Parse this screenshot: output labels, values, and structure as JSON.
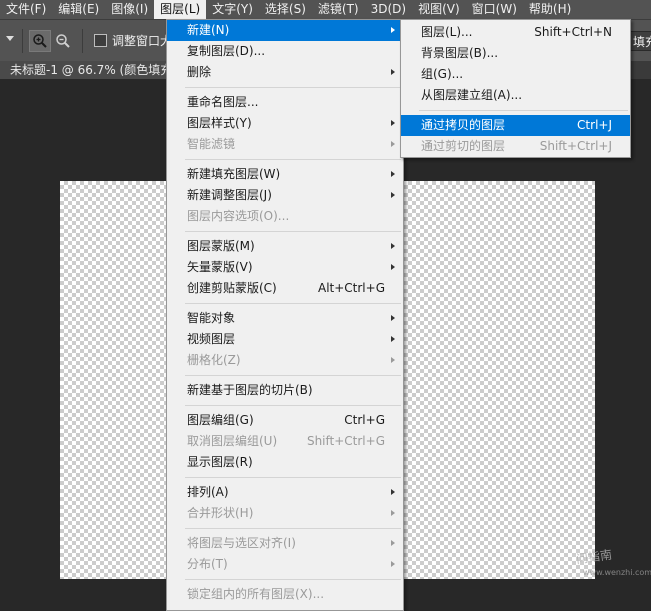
{
  "menubar": {
    "items": [
      "文件(F)",
      "编辑(E)",
      "图像(I)",
      "图层(L)",
      "文字(Y)",
      "选择(S)",
      "滤镜(T)",
      "3D(D)",
      "视图(V)",
      "窗口(W)",
      "帮助(H)"
    ]
  },
  "options": {
    "zoom_in_icon": "zoom-in-icon",
    "zoom_out_icon": "zoom-out-icon",
    "resize_label": "调整窗口大",
    "fill_label": "填充"
  },
  "document": {
    "tab_title": "未标题-1 @ 66.7% (颜色填充"
  },
  "layer_menu": {
    "items": [
      {
        "label": "新建(N)",
        "shortcut": "",
        "submenu": true,
        "disabled": false,
        "highlight": true
      },
      {
        "label": "复制图层(D)...",
        "shortcut": "",
        "submenu": false,
        "disabled": false
      },
      {
        "label": "删除",
        "shortcut": "",
        "submenu": true,
        "disabled": false
      },
      {
        "label": "重命名图层...",
        "shortcut": "",
        "submenu": false,
        "disabled": false
      },
      {
        "label": "图层样式(Y)",
        "shortcut": "",
        "submenu": true,
        "disabled": false
      },
      {
        "label": "智能滤镜",
        "shortcut": "",
        "submenu": true,
        "disabled": true
      },
      {
        "label": "新建填充图层(W)",
        "shortcut": "",
        "submenu": true,
        "disabled": false
      },
      {
        "label": "新建调整图层(J)",
        "shortcut": "",
        "submenu": true,
        "disabled": false
      },
      {
        "label": "图层内容选项(O)...",
        "shortcut": "",
        "submenu": false,
        "disabled": true
      },
      {
        "label": "图层蒙版(M)",
        "shortcut": "",
        "submenu": true,
        "disabled": false
      },
      {
        "label": "矢量蒙版(V)",
        "shortcut": "",
        "submenu": true,
        "disabled": false
      },
      {
        "label": "创建剪贴蒙版(C)",
        "shortcut": "Alt+Ctrl+G",
        "submenu": false,
        "disabled": false
      },
      {
        "label": "智能对象",
        "shortcut": "",
        "submenu": true,
        "disabled": false
      },
      {
        "label": "视频图层",
        "shortcut": "",
        "submenu": true,
        "disabled": false
      },
      {
        "label": "栅格化(Z)",
        "shortcut": "",
        "submenu": true,
        "disabled": true
      },
      {
        "label": "新建基于图层的切片(B)",
        "shortcut": "",
        "submenu": false,
        "disabled": false
      },
      {
        "label": "图层编组(G)",
        "shortcut": "Ctrl+G",
        "submenu": false,
        "disabled": false
      },
      {
        "label": "取消图层编组(U)",
        "shortcut": "Shift+Ctrl+G",
        "submenu": false,
        "disabled": true
      },
      {
        "label": "显示图层(R)",
        "shortcut": "",
        "submenu": false,
        "disabled": false
      },
      {
        "label": "排列(A)",
        "shortcut": "",
        "submenu": true,
        "disabled": false
      },
      {
        "label": "合并形状(H)",
        "shortcut": "",
        "submenu": true,
        "disabled": true
      },
      {
        "label": "将图层与选区对齐(I)",
        "shortcut": "",
        "submenu": true,
        "disabled": true
      },
      {
        "label": "分布(T)",
        "shortcut": "",
        "submenu": true,
        "disabled": true
      },
      {
        "label": "锁定组内的所有图层(X)...",
        "shortcut": "",
        "submenu": false,
        "disabled": true
      }
    ]
  },
  "new_submenu": {
    "items": [
      {
        "label": "图层(L)...",
        "shortcut": "Shift+Ctrl+N",
        "disabled": false
      },
      {
        "label": "背景图层(B)...",
        "shortcut": "",
        "disabled": false
      },
      {
        "label": "组(G)...",
        "shortcut": "",
        "disabled": false
      },
      {
        "label": "从图层建立组(A)...",
        "shortcut": "",
        "disabled": false
      },
      {
        "label": "通过拷贝的图层",
        "shortcut": "Ctrl+J",
        "disabled": false,
        "highlight": true
      },
      {
        "label": "通过剪切的图层",
        "shortcut": "Shift+Ctrl+J",
        "disabled": true
      }
    ]
  },
  "watermark": {
    "text": "问指南",
    "url": "www.wenzhi.com"
  }
}
